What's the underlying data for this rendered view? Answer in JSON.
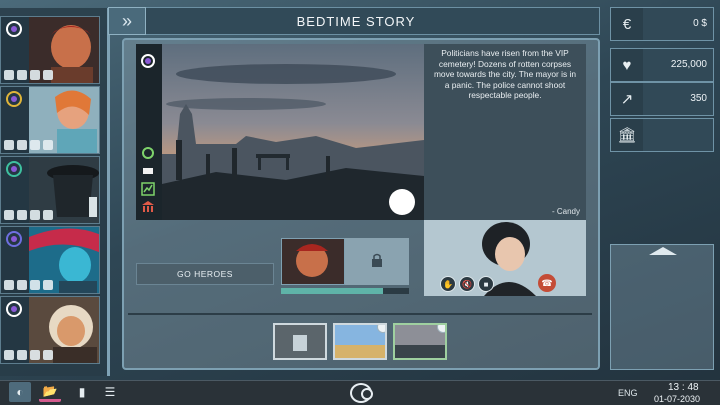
{
  "header": {
    "title": "BEDTIME STORY",
    "back_icon": "double-chevron-right-icon"
  },
  "roster": {
    "heroes": [
      {
        "name_icon": "hero-1",
        "badge_color": "#8a59d6",
        "stats": [
          "fist-icon",
          "sparkle-icon",
          "alert-icon",
          "shield-icon"
        ]
      },
      {
        "name_icon": "hero-2",
        "badge_color": "#e0b53a",
        "stats": [
          "building-icon",
          "sparkle-icon",
          "alert-icon",
          "shield-icon"
        ]
      },
      {
        "name_icon": "hero-3",
        "badge_color": "#3ec1a0",
        "stats": [
          "wings-icon",
          "sparkle-icon",
          "alert-icon",
          "shield-icon"
        ]
      },
      {
        "name_icon": "hero-4",
        "badge_color": "#6f6fe0",
        "stats": [
          "building-icon",
          "sparkle-icon",
          "alert-icon",
          "shield-icon"
        ]
      },
      {
        "name_icon": "hero-5",
        "badge_color": "#8a59d6",
        "stats": [
          "fist-icon",
          "sparkle-icon",
          "alert-icon",
          "shield-icon"
        ]
      }
    ]
  },
  "story": {
    "text": "Politicians have risen from the VIP cemetery! Dozens of rotten corpses move towards the city. The mayor is in a panic. The police cannot shoot respectable people.",
    "signature": "- Candy"
  },
  "actions": {
    "go_heroes": "GO HEROES"
  },
  "mission": {
    "progress": 0.8
  },
  "stats": {
    "money": "0 $",
    "followers": "225,000",
    "reputation": "350"
  },
  "taskbar": {
    "lang": "ENG",
    "time": "13 : 48",
    "date": "01-07-2030"
  },
  "colors": {
    "accent": "#7fa2b5",
    "progress": "#5fb3a8",
    "hangup": "#c44c36",
    "badge": "#8a59d6"
  }
}
